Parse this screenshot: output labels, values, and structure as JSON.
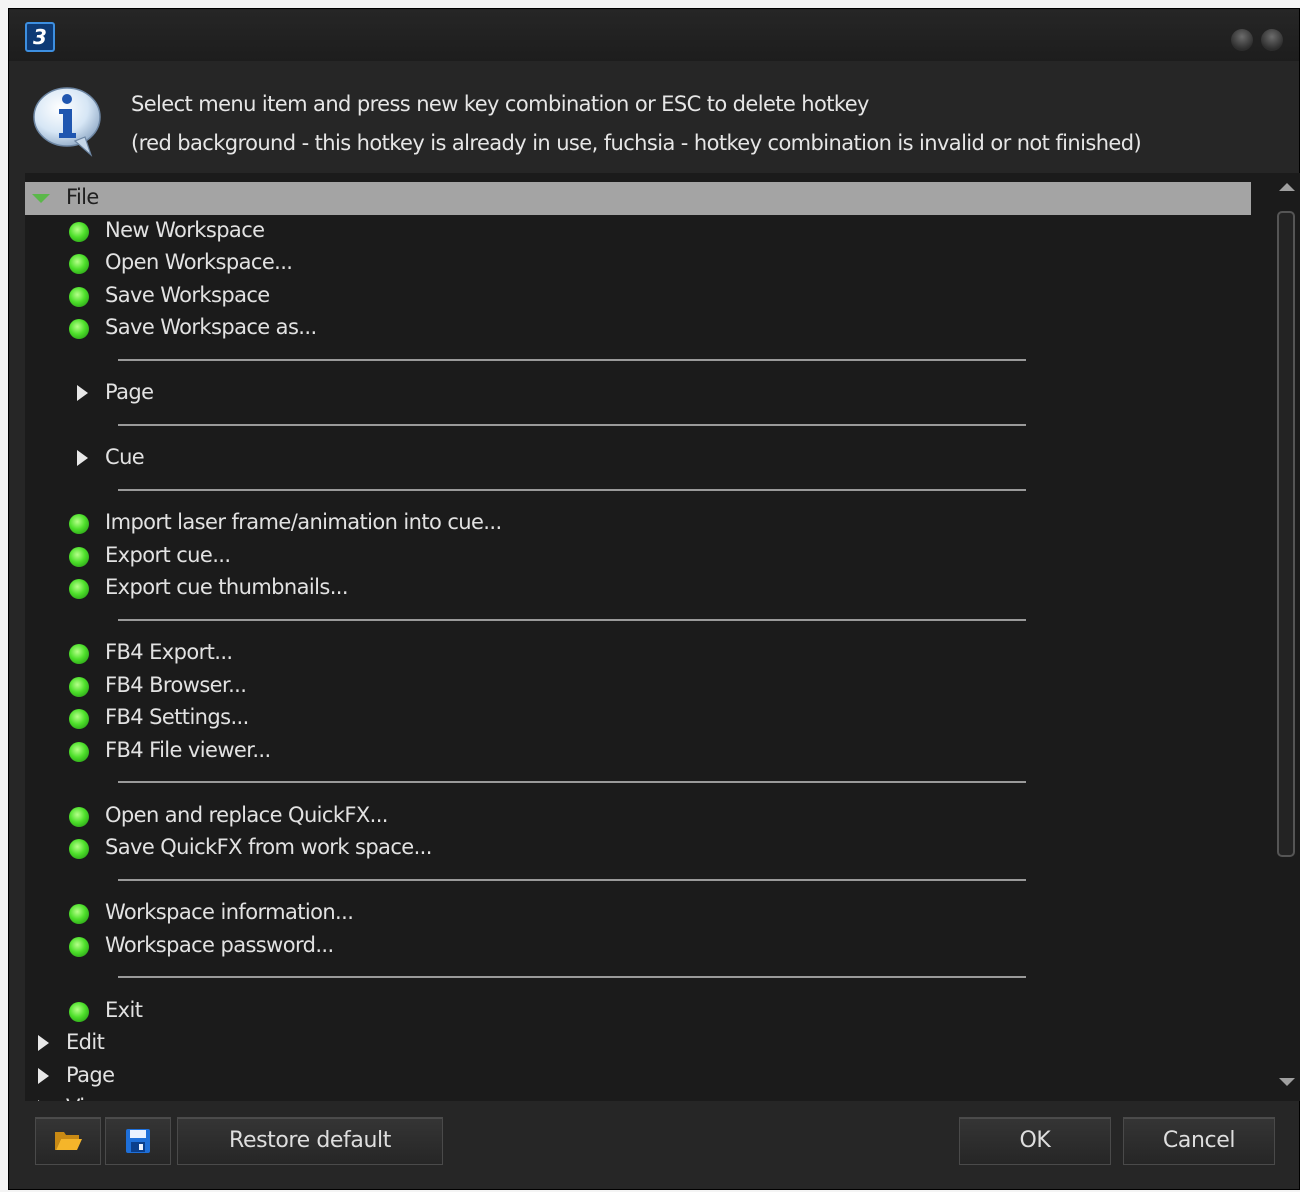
{
  "window": {
    "app_icon": "app-logo-icon",
    "app_icon_text": "3",
    "controls": [
      "minimize-icon",
      "close-icon"
    ]
  },
  "info": {
    "icon": "info-icon",
    "line1": "Select menu item and press new key combination or ESC to delete hotkey",
    "line2": "(red background - this hotkey is already in use, fuchsia - hotkey combination is invalid or not finished)"
  },
  "tree": {
    "rows": [
      {
        "kind": "group",
        "label": "File",
        "expanded": true,
        "selected": true
      },
      {
        "kind": "item",
        "label": "New Workspace"
      },
      {
        "kind": "item",
        "label": "Open Workspace..."
      },
      {
        "kind": "item",
        "label": "Save Workspace"
      },
      {
        "kind": "item",
        "label": "Save Workspace as..."
      },
      {
        "kind": "separator"
      },
      {
        "kind": "submenu",
        "label": "Page"
      },
      {
        "kind": "separator"
      },
      {
        "kind": "submenu",
        "label": "Cue"
      },
      {
        "kind": "separator"
      },
      {
        "kind": "item",
        "label": "Import laser frame/animation into cue..."
      },
      {
        "kind": "item",
        "label": "Export cue..."
      },
      {
        "kind": "item",
        "label": "Export cue thumbnails..."
      },
      {
        "kind": "separator"
      },
      {
        "kind": "item",
        "label": "FB4 Export..."
      },
      {
        "kind": "item",
        "label": "FB4 Browser..."
      },
      {
        "kind": "item",
        "label": "FB4 Settings..."
      },
      {
        "kind": "item",
        "label": "FB4 File viewer..."
      },
      {
        "kind": "separator"
      },
      {
        "kind": "item",
        "label": "Open and replace QuickFX..."
      },
      {
        "kind": "item",
        "label": "Save QuickFX from work space..."
      },
      {
        "kind": "separator"
      },
      {
        "kind": "item",
        "label": "Workspace information..."
      },
      {
        "kind": "item",
        "label": "Workspace password..."
      },
      {
        "kind": "separator"
      },
      {
        "kind": "item",
        "label": "Exit"
      },
      {
        "kind": "group",
        "label": "Edit",
        "expanded": false
      },
      {
        "kind": "group",
        "label": "Page",
        "expanded": false
      },
      {
        "kind": "group",
        "label": "View",
        "expanded": false
      }
    ],
    "bullet_color": "#4ee02b",
    "selected_row_color": "#a4a4a4"
  },
  "scrollbar": {
    "up_icon": "scroll-up-arrow-icon",
    "down_icon": "scroll-down-arrow-icon"
  },
  "footer": {
    "open_icon": "folder-open-icon",
    "save_icon": "floppy-disk-icon",
    "restore_label": "Restore default",
    "ok_label": "OK",
    "cancel_label": "Cancel"
  }
}
